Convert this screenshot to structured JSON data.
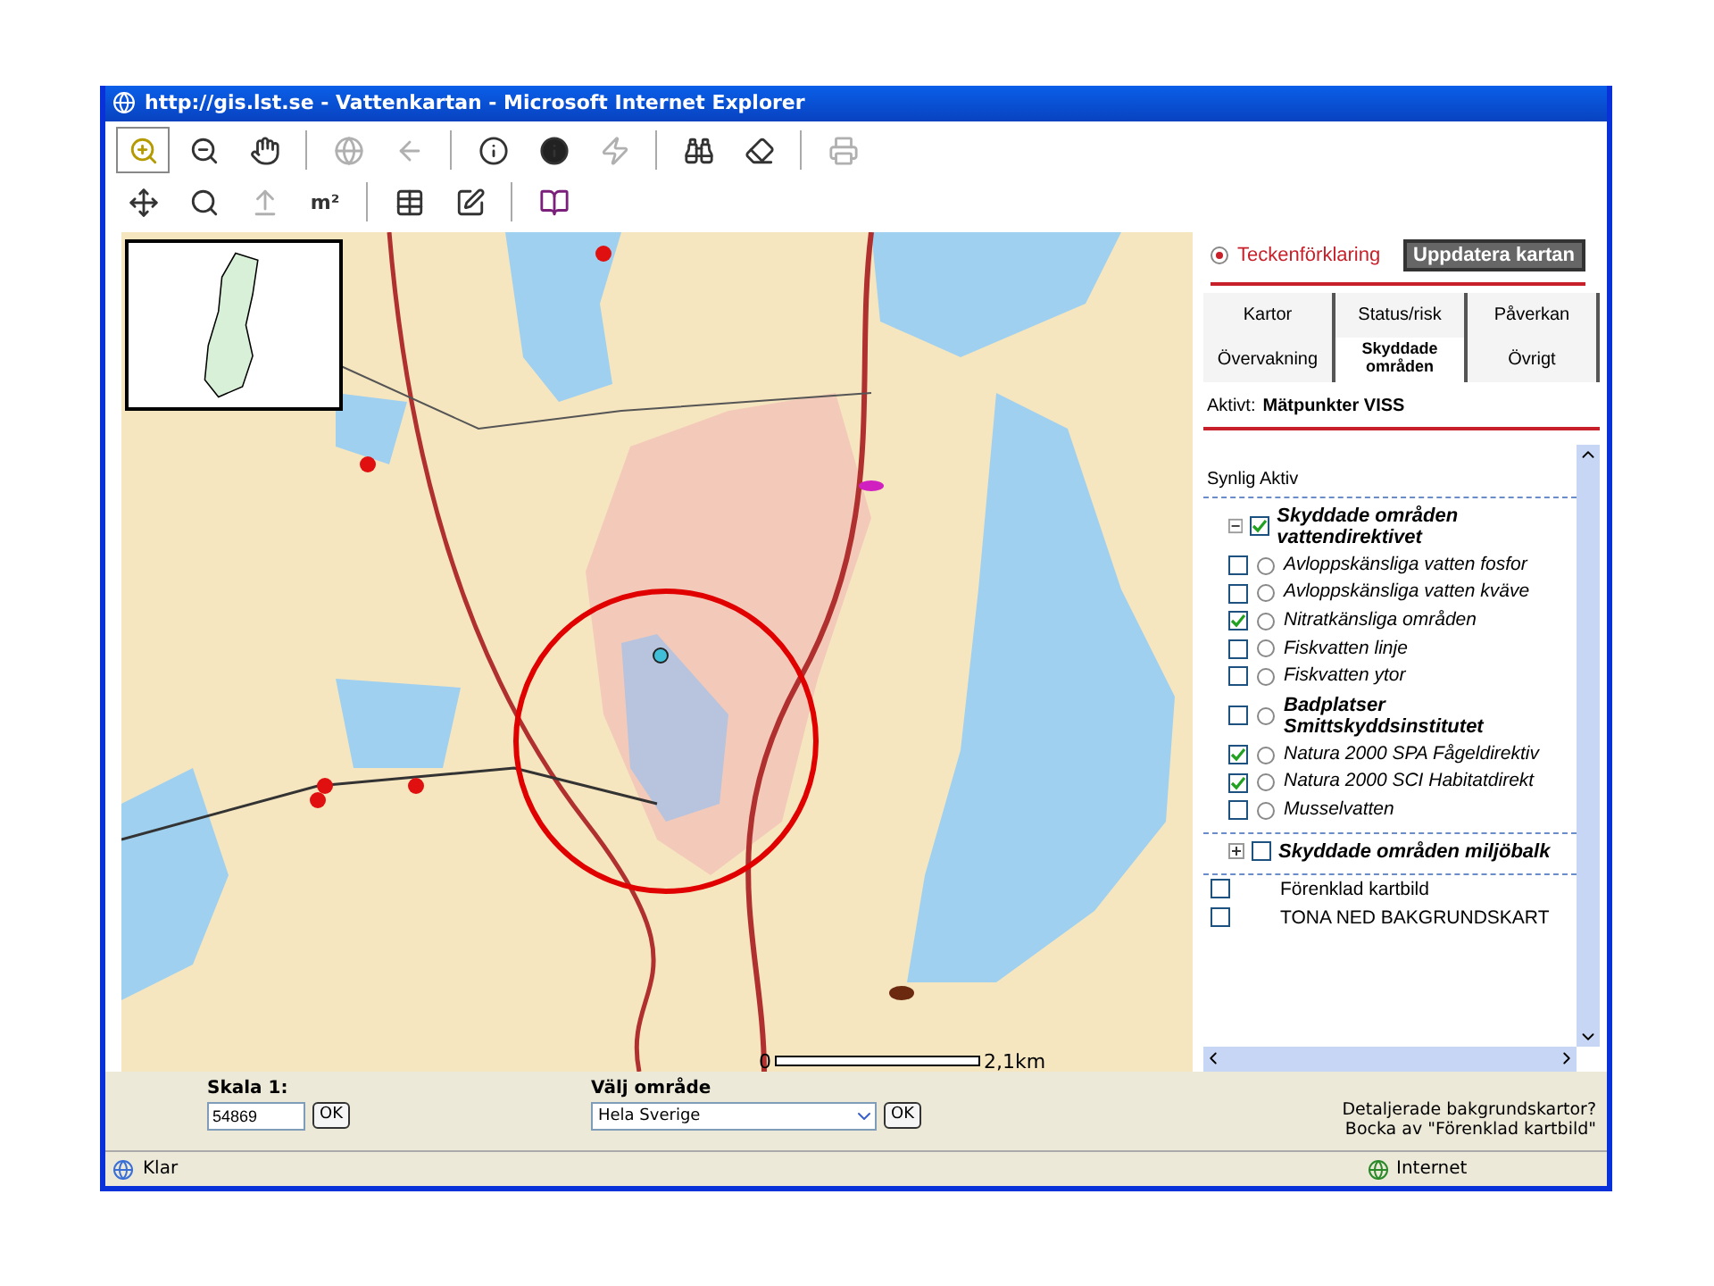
{
  "window": {
    "title": "http://gis.lst.se - Vattenkartan - Microsoft Internet Explorer"
  },
  "toolbar": {
    "rows": [
      [
        {
          "kind": "zoom-in",
          "selected": true,
          "disabled": false
        },
        {
          "kind": "zoom-out",
          "selected": false,
          "disabled": false
        },
        {
          "kind": "pan",
          "selected": false,
          "disabled": false
        },
        {
          "kind": "separator"
        },
        {
          "kind": "globe",
          "selected": false,
          "disabled": true
        },
        {
          "kind": "back",
          "selected": false,
          "disabled": true
        },
        {
          "kind": "separator"
        },
        {
          "kind": "info",
          "selected": false,
          "disabled": false
        },
        {
          "kind": "info-dark",
          "selected": false,
          "disabled": false
        },
        {
          "kind": "lightning",
          "selected": false,
          "disabled": true
        },
        {
          "kind": "separator"
        },
        {
          "kind": "binoculars",
          "selected": false,
          "disabled": false
        },
        {
          "kind": "eraser",
          "selected": false,
          "disabled": false
        },
        {
          "kind": "separator"
        },
        {
          "kind": "printer",
          "selected": false,
          "disabled": true
        }
      ],
      [
        {
          "kind": "measure",
          "selected": false,
          "disabled": false
        },
        {
          "kind": "zoom-xy",
          "selected": false,
          "disabled": false
        },
        {
          "kind": "upload",
          "selected": false,
          "disabled": true
        },
        {
          "kind": "area",
          "label": "m²",
          "selected": false,
          "disabled": false
        },
        {
          "kind": "separator"
        },
        {
          "kind": "table",
          "selected": false,
          "disabled": false
        },
        {
          "kind": "table-edit",
          "selected": false,
          "disabled": false
        },
        {
          "kind": "separator"
        },
        {
          "kind": "help-book",
          "selected": false,
          "disabled": false
        }
      ]
    ]
  },
  "map": {
    "scale_start": "0",
    "scale_end": "2,1km"
  },
  "panel": {
    "legend": {
      "label": "Teckenförklaring",
      "selected": true
    },
    "update_button": "Uppdatera kartan",
    "tabs": [
      {
        "label": "Kartor",
        "selected": false
      },
      {
        "label": "Status/risk",
        "selected": false
      },
      {
        "label": "Påverkan",
        "selected": false
      },
      {
        "label": "Övervakning",
        "selected": false
      },
      {
        "label": "Skyddade områden",
        "selected": true
      },
      {
        "label": "Övrigt",
        "selected": false
      }
    ],
    "active_label": "Aktivt:",
    "active_value": "Mätpunkter VISS",
    "column_header": "Synlig Aktiv",
    "groups": [
      {
        "title": "Skyddade områden vattendirektivet",
        "expanded": true,
        "checked": true,
        "items": [
          {
            "label": "Avloppskänsliga vatten fosfor",
            "checked": false,
            "active": false,
            "bold": false
          },
          {
            "label": "Avloppskänsliga vatten kväve",
            "checked": false,
            "active": false,
            "bold": false
          },
          {
            "label": "Nitratkänsliga områden",
            "checked": true,
            "active": false,
            "bold": false
          },
          {
            "label": "Fiskvatten linje",
            "checked": false,
            "active": false,
            "bold": false
          },
          {
            "label": "Fiskvatten ytor",
            "checked": false,
            "active": false,
            "bold": false
          },
          {
            "label": "Badplatser Smittskyddsinstitutet",
            "checked": false,
            "active": false,
            "bold": true
          },
          {
            "label": "Natura 2000 SPA Fågeldirektiv",
            "checked": true,
            "active": false,
            "bold": false
          },
          {
            "label": "Natura 2000 SCI Habitatdirekt",
            "checked": true,
            "active": false,
            "bold": false
          },
          {
            "label": "Musselvatten",
            "checked": false,
            "active": false,
            "bold": false
          }
        ]
      },
      {
        "title": "Skyddade områden miljöbalk",
        "expanded": false,
        "checked": false
      }
    ],
    "options": [
      {
        "label": "Förenklad kartbild",
        "checked": false
      },
      {
        "label": "TONA NED BAKGRUNDSKART",
        "checked": false
      }
    ]
  },
  "bottom": {
    "scale_label": "Skala 1:",
    "scale_value": "54869",
    "ok": "OK",
    "area_label": "Välj område",
    "area_value": "Hela Sverige",
    "area_ok": "OK",
    "note_lines": [
      "Detaljerade bakgrundskartor?",
      "Bocka av \"Förenklad kartbild\""
    ]
  },
  "status_bar": {
    "status": "Klar",
    "zone": "Internet"
  }
}
